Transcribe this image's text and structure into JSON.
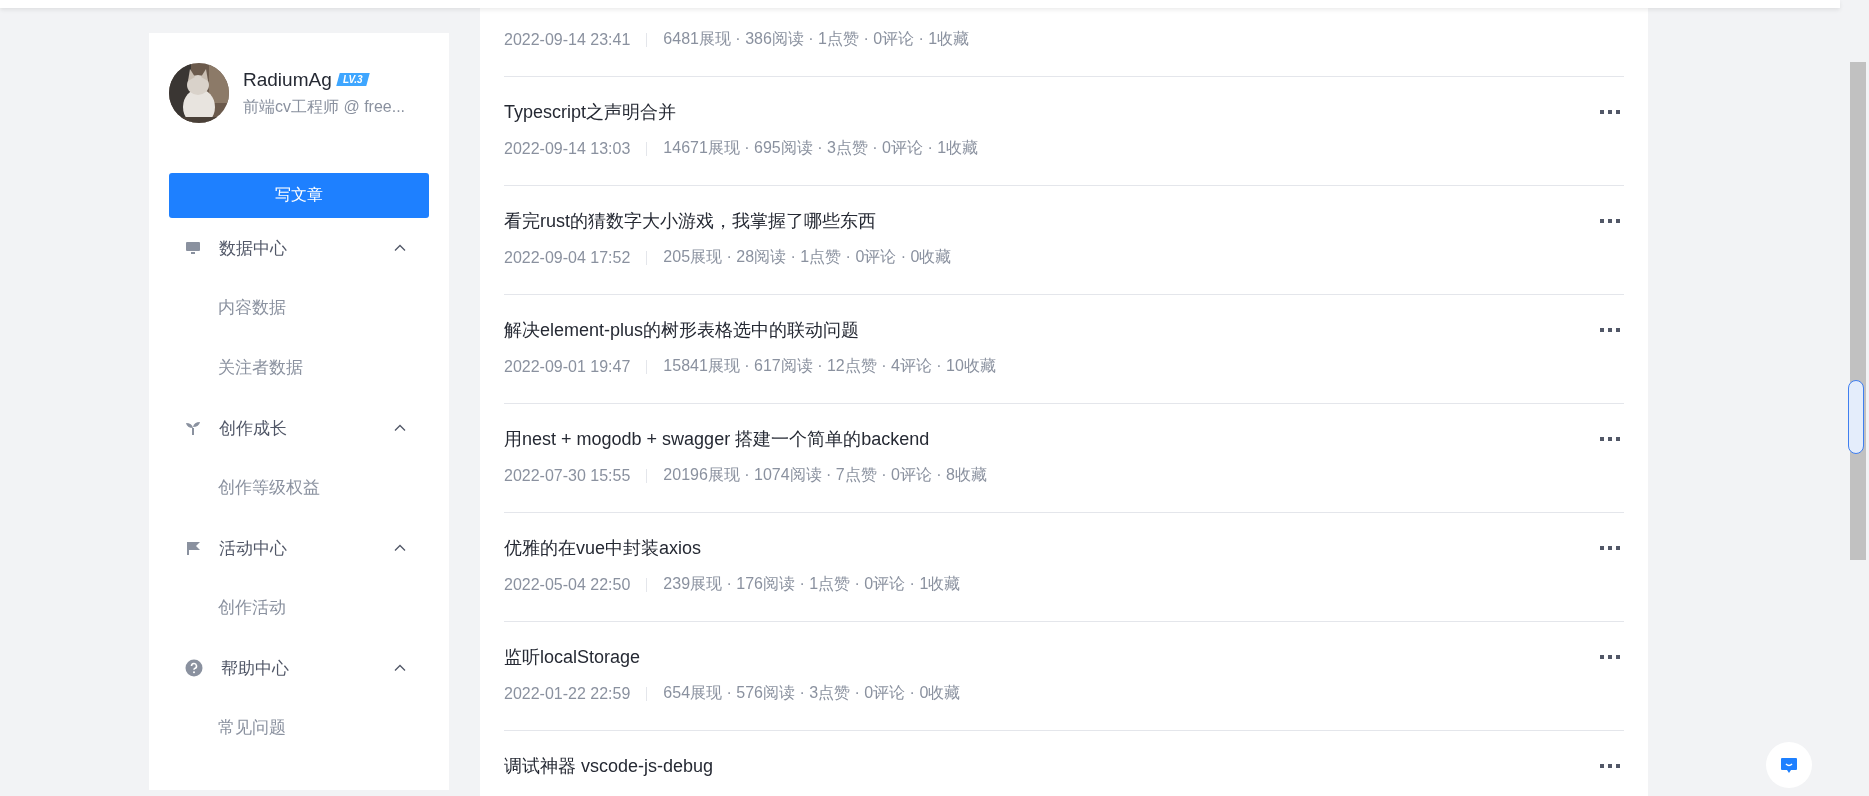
{
  "profile": {
    "name": "RadiumAg",
    "level_badge": "LV.3",
    "bio": "前端cv工程师 @ free..."
  },
  "write_button": "写文章",
  "menu": [
    {
      "label": "数据中心",
      "expanded": true,
      "children": [
        "内容数据",
        "关注者数据"
      ]
    },
    {
      "label": "创作成长",
      "expanded": true,
      "children": [
        "创作等级权益"
      ]
    },
    {
      "label": "活动中心",
      "expanded": true,
      "children": [
        "创作活动"
      ]
    },
    {
      "label": "帮助中心",
      "expanded": true,
      "children": [
        "常见问题"
      ]
    }
  ],
  "articles": [
    {
      "date": "2022-09-14 23:41",
      "stats": "6481展现 · 386阅读 · 1点赞 · 0评论 · 1收藏"
    },
    {
      "title": "Typescript之声明合并",
      "date": "2022-09-14 13:03",
      "stats": "14671展现 · 695阅读 · 3点赞 · 0评论 · 1收藏"
    },
    {
      "title": "看完rust的猜数字大小游戏，我掌握了哪些东西",
      "date": "2022-09-04 17:52",
      "stats": "205展现 · 28阅读 · 1点赞 · 0评论 · 0收藏"
    },
    {
      "title": "解决element-plus的树形表格选中的联动问题",
      "date": "2022-09-01 19:47",
      "stats": "15841展现 · 617阅读 · 12点赞 · 4评论 · 10收藏"
    },
    {
      "title": "用nest + mogodb + swagger 搭建一个简单的backend",
      "date": "2022-07-30 15:55",
      "stats": "20196展现 · 1074阅读 · 7点赞 · 0评论 · 8收藏"
    },
    {
      "title": "优雅的在vue中封装axios",
      "date": "2022-05-04 22:50",
      "stats": "239展现 · 176阅读 · 1点赞 · 0评论 · 1收藏"
    },
    {
      "title": "监听localStorage",
      "date": "2022-01-22 22:59",
      "stats": "654展现 · 576阅读 · 3点赞 · 0评论 · 0收藏"
    },
    {
      "title": "调试神器 vscode-js-debug"
    }
  ]
}
